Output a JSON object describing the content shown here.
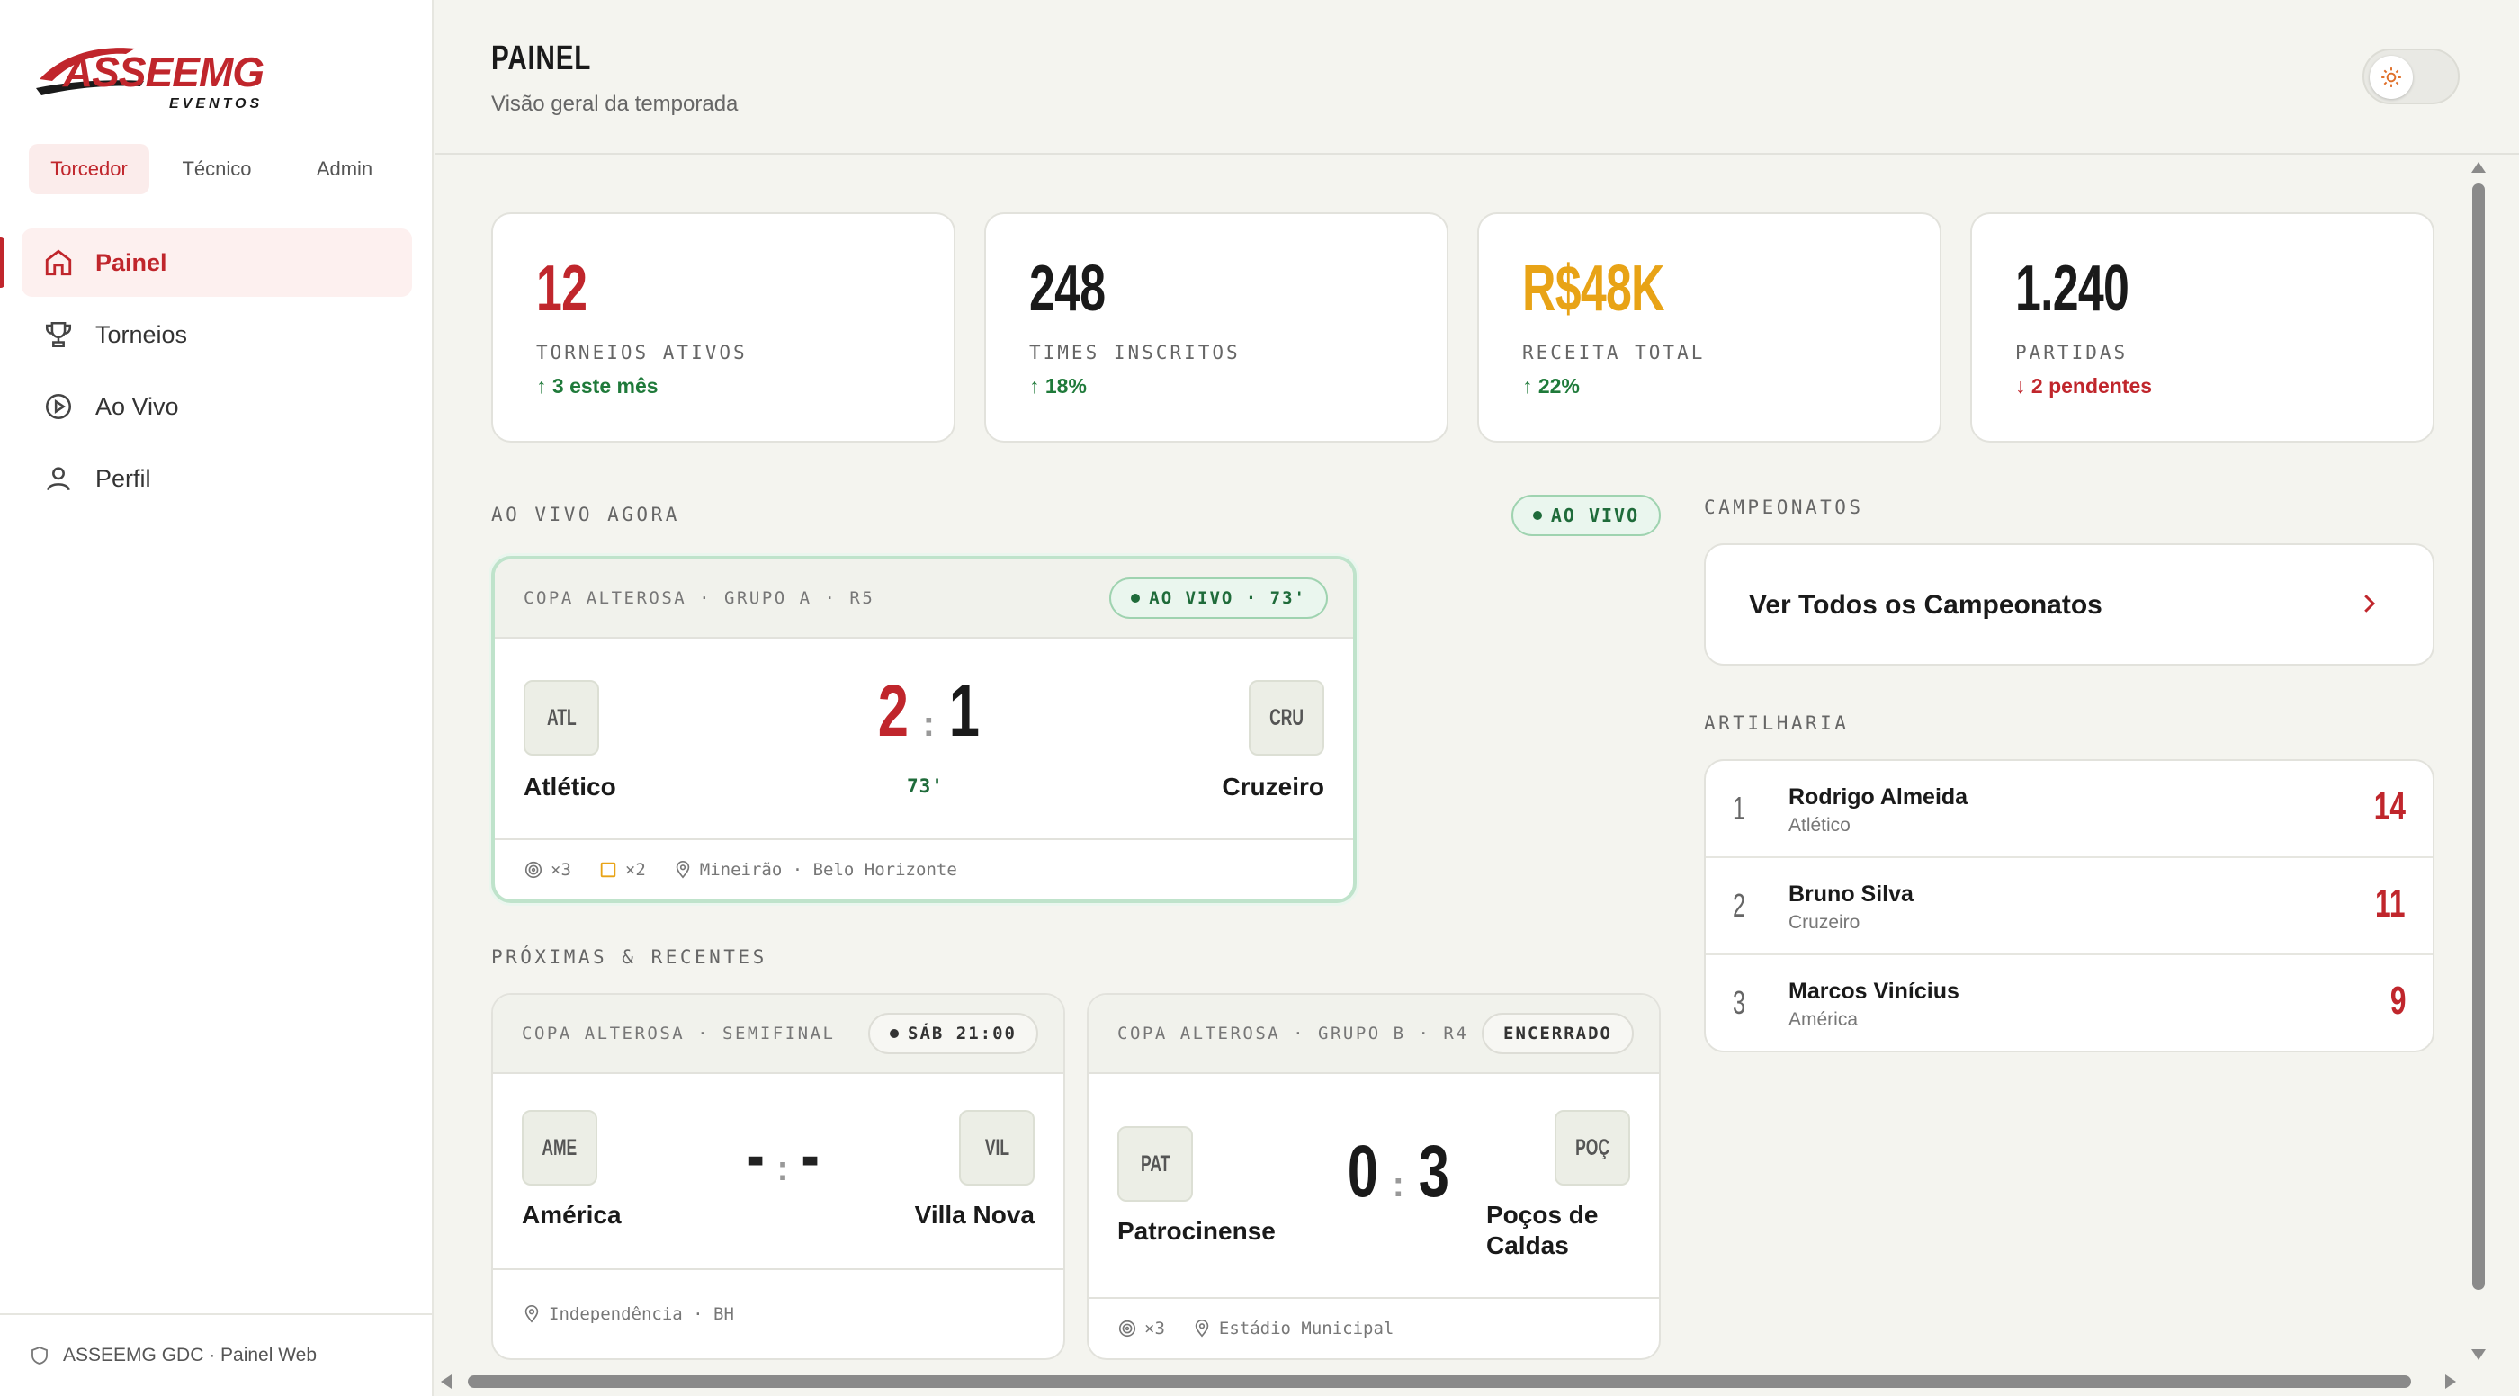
{
  "brand": {
    "name": "ASSEEMG",
    "sub": "EVENTOS",
    "accent": "#c0262c"
  },
  "roles": [
    "Torcedor",
    "Técnico",
    "Admin"
  ],
  "nav": [
    {
      "label": "Painel",
      "icon": "home-icon",
      "active": true
    },
    {
      "label": "Torneios",
      "icon": "trophy-icon"
    },
    {
      "label": "Ao Vivo",
      "icon": "play-circle-icon"
    },
    {
      "label": "Perfil",
      "icon": "user-icon"
    }
  ],
  "footer": "ASSEEMG GDC · Painel Web",
  "header": {
    "title": "PAINEL",
    "subtitle": "Visão geral da temporada"
  },
  "stats": [
    {
      "value": "12",
      "label": "TORNEIOS ATIVOS",
      "delta": "↑ 3 este mês",
      "color": "#c0262c"
    },
    {
      "value": "248",
      "label": "TIMES INSCRITOS",
      "delta": "↑ 18%",
      "color": "#1a1a1a"
    },
    {
      "value": "R$48K",
      "label": "RECEITA TOTAL",
      "delta": "↑ 22%",
      "color": "#e8a316"
    },
    {
      "value": "1.240",
      "label": "PARTIDAS",
      "delta": "↓ 2 pendentes",
      "color": "#1a1a1a"
    }
  ],
  "sections": {
    "live": "AO VIVO AGORA",
    "live_pill": "AO VIVO",
    "upcoming": "PRÓXIMAS & RECENTES",
    "championships": "CAMPEONATOS",
    "scorers": "ARTILHARIA"
  },
  "live_match": {
    "competition": "COPA ALTEROSA · GRUPO A · R5",
    "badge": "AO VIVO · 73'",
    "home": {
      "code": "ATL",
      "name": "Atlético",
      "score": "2"
    },
    "away": {
      "code": "CRU",
      "name": "Cruzeiro",
      "score": "1"
    },
    "minute": "73'",
    "goals": "×3",
    "cards": "×2",
    "venue": "Mineirão · Belo Horizonte"
  },
  "match_2": {
    "competition": "COPA ALTEROSA · SEMIFINAL",
    "badge": "SÁB 21:00",
    "home": {
      "code": "AME",
      "name": "América",
      "score": "-"
    },
    "away": {
      "code": "VIL",
      "name": "Villa Nova",
      "score": "-"
    },
    "venue": "Independência · BH"
  },
  "match_3": {
    "competition": "COPA ALTEROSA · GRUPO B · R4",
    "badge": "ENCERRADO",
    "home": {
      "code": "PAT",
      "name": "Patrocinense",
      "score": "0"
    },
    "away": {
      "code": "POÇ",
      "name_line1": "Poços de",
      "name_line2": "Caldas",
      "score": "3"
    },
    "goals": "×3",
    "venue": "Estádio Municipal"
  },
  "championships_link": "Ver Todos os Campeonatos",
  "scorers": [
    {
      "rank": "1",
      "name": "Rodrigo Almeida",
      "team": "Atlético",
      "goals": "14"
    },
    {
      "rank": "2",
      "name": "Bruno Silva",
      "team": "Cruzeiro",
      "goals": "11"
    },
    {
      "rank": "3",
      "name": "Marcos Vinícius",
      "team": "América",
      "goals": "9"
    }
  ]
}
